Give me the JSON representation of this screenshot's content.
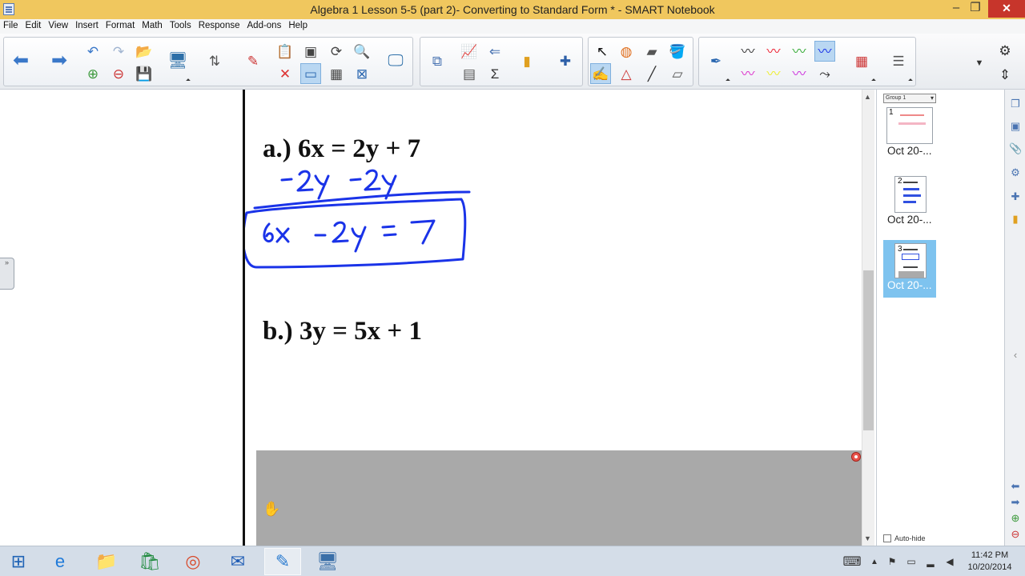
{
  "window": {
    "title": "Algebra 1 Lesson 5-5 (part 2)- Converting to Standard Form * - SMART Notebook",
    "minimize": "–",
    "maximize": "❐",
    "close": "✕"
  },
  "menu": [
    "File",
    "Edit",
    "View",
    "Insert",
    "Format",
    "Math",
    "Tools",
    "Response",
    "Add-ons",
    "Help"
  ],
  "page": {
    "problem_a": "a.) 6x = 2y + 7",
    "problem_b": "b.) 3y = 5x + 1",
    "handwriting": {
      "ink_color": "#1a33e8",
      "step_line": "-2y   -2y",
      "answer": "6x - 2y = 7"
    },
    "screen_shade": {
      "color": "#a9a9a9"
    }
  },
  "sorter": {
    "group_selector": "Group 1",
    "pages": [
      {
        "number": "1",
        "label": "Oct 20-...",
        "selected": false
      },
      {
        "number": "2",
        "label": "Oct 20-...",
        "selected": false
      },
      {
        "number": "3",
        "label": "Oct 20-...",
        "selected": true
      }
    ],
    "auto_hide": "Auto-hide"
  },
  "taskbar": {
    "time": "11:42 PM",
    "date": "10/20/2014"
  },
  "colors": {
    "titlebar": "#f0c75e",
    "ink": "#1a33e8",
    "selection": "#7ec3ef"
  }
}
